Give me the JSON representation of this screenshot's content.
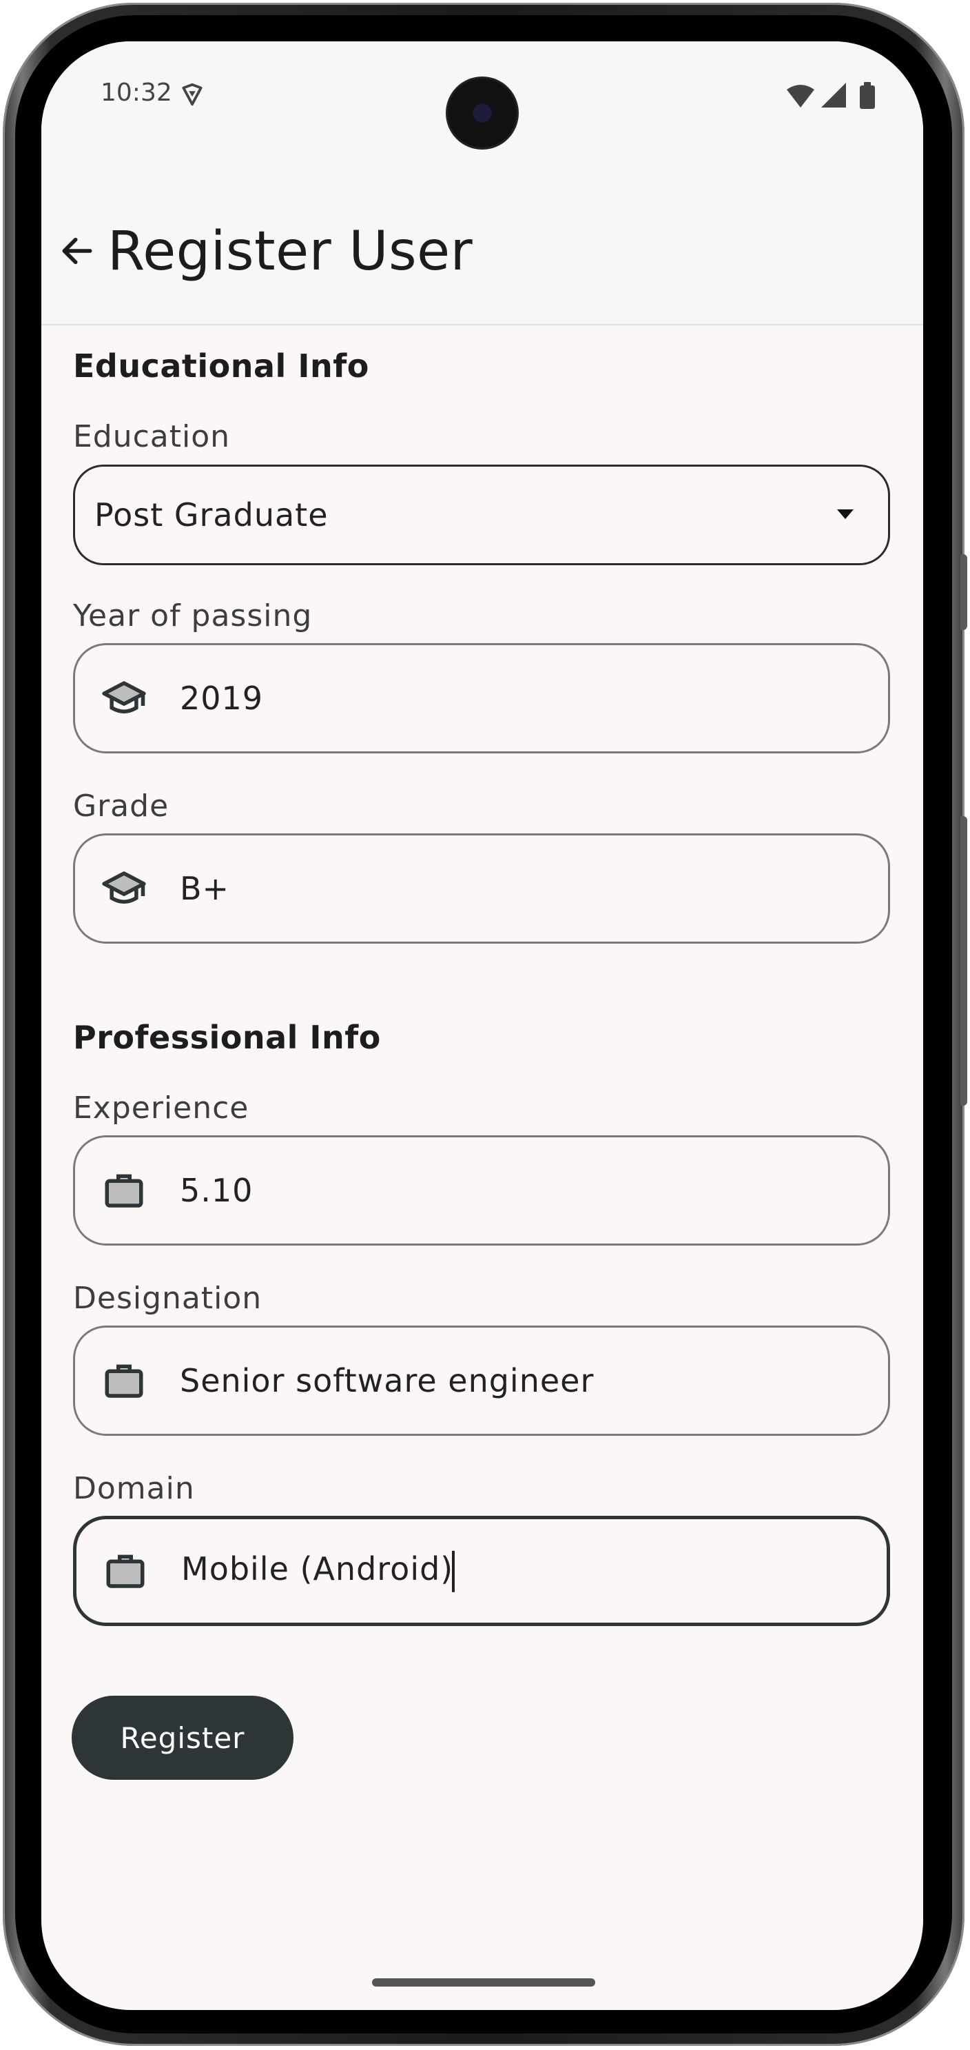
{
  "status_bar": {
    "time": "10:32"
  },
  "app_bar": {
    "title": "Register User"
  },
  "educational": {
    "section_title": "Educational Info",
    "education": {
      "label": "Education",
      "value": "Post Graduate"
    },
    "year": {
      "label": "Year of passing",
      "value": "2019"
    },
    "grade": {
      "label": "Grade",
      "value": "B+"
    }
  },
  "professional": {
    "section_title": "Professional Info",
    "experience": {
      "label": "Experience",
      "value": "5.10"
    },
    "designation": {
      "label": "Designation",
      "value": "Senior software engineer"
    },
    "domain": {
      "label": "Domain",
      "value": "Mobile (Android)"
    }
  },
  "actions": {
    "register_label": "Register"
  },
  "icons": {
    "back": "arrow-back-icon",
    "education": "graduation-cap-icon",
    "work": "briefcase-icon"
  },
  "colors": {
    "primary": "#2d3536",
    "background": "#faf7f6"
  }
}
